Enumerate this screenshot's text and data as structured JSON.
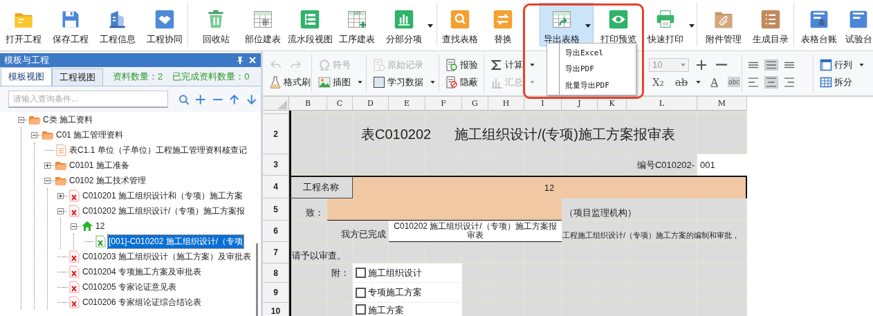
{
  "toolbar": {
    "groups": [
      [
        {
          "label": "打开工程",
          "selected": false,
          "dropdown": false
        },
        {
          "label": "保存工程",
          "selected": false,
          "dropdown": false
        },
        {
          "label": "工程信息",
          "selected": false,
          "dropdown": false
        },
        {
          "label": "工程协同",
          "selected": false,
          "dropdown": false
        }
      ],
      [
        {
          "label": "回收站",
          "selected": false,
          "dropdown": false
        },
        {
          "label": "部位建表",
          "glyph": "部",
          "selected": false,
          "dropdown": false
        },
        {
          "label": "流水段视图",
          "selected": false,
          "dropdown": false
        },
        {
          "label": "工序建表",
          "glyph": "123",
          "selected": false,
          "dropdown": false
        },
        {
          "label": "分部分项",
          "selected": false,
          "dropdown": true
        }
      ],
      [
        {
          "label": "查找表格",
          "selected": false,
          "dropdown": false
        },
        {
          "label": "替换",
          "selected": false,
          "dropdown": false
        }
      ],
      [
        {
          "label": "导出表格",
          "selected": true,
          "dropdown": true
        },
        {
          "label": "打印预览",
          "selected": false,
          "dropdown": false
        },
        {
          "label": "快速打印",
          "selected": false,
          "dropdown": true
        }
      ],
      [
        {
          "label": "附件管理",
          "selected": false,
          "dropdown": false
        },
        {
          "label": "生成目录",
          "selected": false,
          "dropdown": false
        }
      ],
      [
        {
          "label": "表格台账",
          "glyph": "表",
          "selected": false,
          "dropdown": false
        },
        {
          "label": "试验台",
          "selected": false,
          "dropdown": false
        }
      ]
    ]
  },
  "export_menu": {
    "items": [
      "导出Excel",
      "导出PDF",
      "批量导出PDF"
    ]
  },
  "panel": {
    "title": "模板与工程",
    "tabs": [
      {
        "label": "模板视图",
        "selected": true
      },
      {
        "label": "工程视图",
        "selected": false
      }
    ],
    "stats": [
      "资料数量：2",
      "已完成资料数量：0"
    ],
    "search": {
      "placeholder": "请输入查询条件..."
    },
    "tree": [
      {
        "label": "C类 施工资料",
        "kind": "folder",
        "expanded": true,
        "selected": false,
        "children": [
          {
            "label": "C01 施工管理资料",
            "kind": "folder",
            "expanded": true,
            "selected": false,
            "children": [
              {
                "label": "表C1.1 单位（子单位）工程施工管理资料核查记",
                "kind": "document",
                "selected": false
              },
              {
                "label": "C0101 施工准备",
                "kind": "folder",
                "expanded": false,
                "selected": false
              },
              {
                "label": "C0102 施工技术管理",
                "kind": "folder",
                "expanded": true,
                "selected": false,
                "children": [
                  {
                    "label": "C010201 施工组织设计和（专项）施工方案",
                    "kind": "form",
                    "expanded": false,
                    "selected": false
                  },
                  {
                    "label": "C010202 施工组织设计/（专项）施工方案报",
                    "kind": "form",
                    "expanded": true,
                    "selected": false,
                    "children": [
                      {
                        "label": "12",
                        "kind": "project",
                        "expanded": true,
                        "selected": false,
                        "children": [
                          {
                            "label": "[001]-C010202 施工组织设计/（专项",
                            "kind": "record",
                            "selected": true
                          }
                        ]
                      }
                    ]
                  },
                  {
                    "label": "C010203 施工组织设计（施工方案）及审批表",
                    "kind": "form",
                    "selected": false
                  },
                  {
                    "label": "C010204 专项施工方案及审批表",
                    "kind": "form",
                    "selected": false
                  },
                  {
                    "label": "C010205 专家论证意见表",
                    "kind": "form",
                    "selected": false
                  },
                  {
                    "label": "C010206 专家组论证综合结论表",
                    "kind": "form",
                    "selected": false
                  }
                ]
              }
            ]
          }
        ]
      }
    ]
  },
  "edit_toolbar": {
    "groups": [
      {
        "rows": [
          [
            {
              "kind": "icon",
              "disabled": true
            },
            {
              "kind": "icon",
              "disabled": true
            }
          ],
          [
            {
              "kind": "button",
              "label": "格式刷",
              "disabled": false,
              "dropdown": false
            }
          ]
        ]
      },
      {
        "rows": [
          [
            {
              "kind": "button",
              "label": "符号",
              "disabled": true,
              "dropdown": false
            }
          ],
          [
            {
              "kind": "button",
              "label": "插图",
              "disabled": false,
              "dropdown": true
            }
          ]
        ]
      },
      {
        "rows": [
          [
            {
              "kind": "button",
              "label": "原始记录",
              "disabled": true,
              "dropdown": false
            }
          ],
          [
            {
              "kind": "button",
              "label": "学习数据",
              "disabled": false,
              "dropdown": true
            }
          ]
        ]
      },
      {
        "rows": [
          [
            {
              "kind": "button",
              "label": "报验",
              "disabled": false,
              "dropdown": false
            }
          ],
          [
            {
              "kind": "button",
              "label": "隐蔽",
              "disabled": false,
              "dropdown": false
            }
          ]
        ]
      },
      {
        "rows": [
          [
            {
              "kind": "button",
              "label": "计算",
              "disabled": false,
              "dropdown": true
            }
          ],
          [
            {
              "kind": "button",
              "label": "汇总",
              "disabled": true,
              "dropdown": true
            }
          ]
        ]
      },
      {
        "rows": [
          [
            {
              "kind": "select",
              "value": "10",
              "disabled": true
            },
            {
              "kind": "icon",
              "disabled": false
            },
            {
              "kind": "icon",
              "disabled": false
            }
          ],
          [
            {
              "kind": "glyph",
              "label": "X₂",
              "disabled": false,
              "dropdown": false
            },
            {
              "kind": "glyph",
              "label": "ab",
              "disabled": false,
              "dropdown": true
            },
            {
              "kind": "glyph",
              "label": "A",
              "disabled": false,
              "dropdown": false
            },
            {
              "kind": "glyph",
              "label": "abc",
              "disabled": false,
              "dropdown": false
            }
          ]
        ]
      },
      {
        "rows": [
          [
            {
              "kind": "icon",
              "selected": false
            },
            {
              "kind": "icon",
              "selected": true
            },
            {
              "kind": "icon",
              "selected": false
            }
          ],
          [
            {
              "kind": "icon",
              "selected": false
            },
            {
              "kind": "icon",
              "selected": true
            },
            {
              "kind": "icon",
              "selected": false
            }
          ]
        ]
      },
      {
        "rows": [
          [
            {
              "kind": "button",
              "label": "行列",
              "disabled": false,
              "dropdown": true
            }
          ],
          [
            {
              "kind": "button",
              "label": "拆分",
              "disabled": false,
              "dropdown": false
            }
          ]
        ]
      }
    ]
  },
  "sheet": {
    "columns": [
      "B",
      "C",
      "D",
      "E",
      "F",
      "G",
      "H",
      "I",
      "J",
      "K",
      "L",
      "M"
    ],
    "rows": [
      "2",
      "3",
      "4",
      "5",
      "6",
      "7",
      "8",
      "9",
      "10"
    ],
    "form": {
      "code": "表C010202",
      "title": "施工组织设计/(专项)施工方案报审表",
      "number_label": "编号C010202-",
      "number_value": "001",
      "project_label": "工程名称",
      "project_value": "12",
      "to_label": "致：",
      "to_suffix": "（项目监理机构）",
      "done_prefix": "我方已完成",
      "done_value": "C010202 施工组织设计/（专项）施工方案报审表",
      "done_suffix": "工程施工组织设计/（专项）施工方案的编制和审批，",
      "request": "请予以审查。",
      "attach_label": "附：",
      "attachments": [
        {
          "label": "施工组织设计",
          "checked": false
        },
        {
          "label": "专项施工方案",
          "checked": false
        },
        {
          "label": "施工方案",
          "checked": false
        }
      ]
    }
  }
}
